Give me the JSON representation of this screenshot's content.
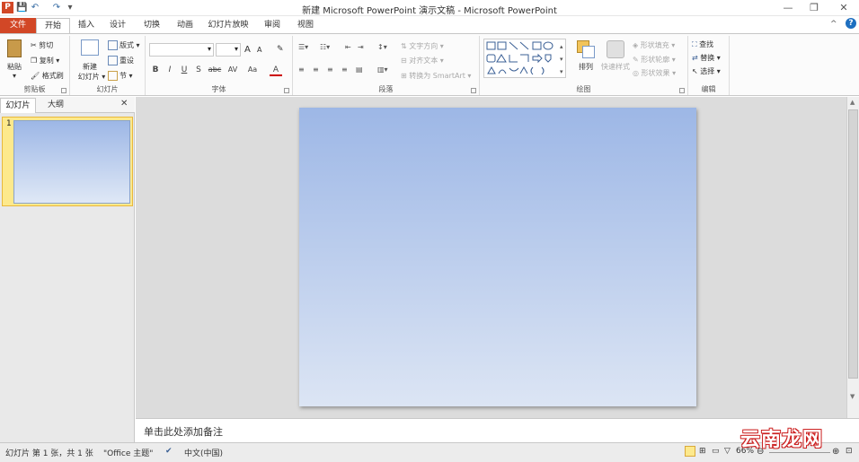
{
  "window": {
    "app_icon": "P",
    "title": "新建 Microsoft PowerPoint 演示文稿 - Microsoft PowerPoint",
    "min_icon": "—",
    "restore_icon": "❐",
    "close_icon": "✕",
    "help_icon": "?",
    "ribbon_min_icon": "^"
  },
  "qat": {
    "save": "💾",
    "undo": "↶",
    "redo": "↷",
    "customize": "▾"
  },
  "tabs": [
    "文件",
    "开始",
    "插入",
    "设计",
    "切换",
    "动画",
    "幻灯片放映",
    "审阅",
    "视图"
  ],
  "ribbon": {
    "clipboard": {
      "label": "剪贴板",
      "paste": "粘贴",
      "cut": "剪切",
      "copy": "复制",
      "format_painter": "格式刷"
    },
    "slides": {
      "label": "幻灯片",
      "new_slide_1": "新建",
      "new_slide_2": "幻灯片 ▾",
      "layout": "版式 ▾",
      "reset": "重设",
      "section": "节 ▾"
    },
    "font": {
      "label": "字体",
      "bold": "B",
      "italic": "I",
      "underline": "U",
      "shadow": "S",
      "strike": "abc",
      "spacing": "AV",
      "case": "Aa",
      "grow": "A",
      "shrink": "A",
      "clear": "✎",
      "color": "A"
    },
    "paragraph": {
      "label": "段落",
      "text_direction": "文字方向 ▾",
      "align_text": "对齐文本 ▾",
      "smartart": "转换为 SmartArt ▾"
    },
    "drawing": {
      "label": "绘图",
      "arrange": "排列",
      "quick_styles": "快速样式",
      "shape_fill": "形状填充 ▾",
      "shape_outline": "形状轮廓 ▾",
      "shape_effects": "形状效果 ▾"
    },
    "editing": {
      "label": "编辑",
      "find": "查找",
      "replace": "替换 ▾",
      "select": "选择 ▾"
    }
  },
  "left_pane": {
    "tab_slides": "幻灯片",
    "tab_outline": "大纲",
    "close": "✕",
    "thumb_number": "1"
  },
  "notes": {
    "placeholder": "单击此处添加备注"
  },
  "status": {
    "slide_info": "幻灯片 第 1 张，共 1 张",
    "theme": "\"Office 主题\"",
    "language": "中文(中国)",
    "zoom": "66%",
    "zoom_out": "⊖",
    "zoom_in": "⊕"
  },
  "watermark": "云南龙网"
}
